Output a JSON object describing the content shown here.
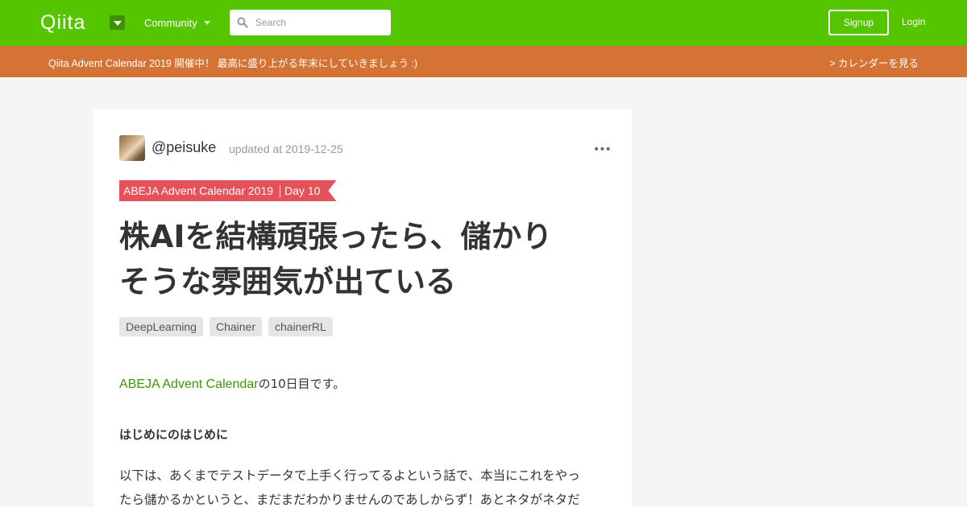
{
  "header": {
    "logo": "Qiita",
    "community_label": "Community",
    "search_placeholder": "Search",
    "signup_label": "Signup",
    "login_label": "Login"
  },
  "announcement": {
    "message": "Qiita Advent Calendar 2019 開催中！ 最高に盛り上がる年末にしていきましょう :)",
    "link": "> カレンダーを見る"
  },
  "article": {
    "author": "@peisuke",
    "updated": "updated at 2019-12-25",
    "more_icon": "•••",
    "calendar": {
      "name": "ABEJA Advent Calendar 2019",
      "day": "Day 10"
    },
    "title_line1": "株AIを結構頑張ったら、儲かり",
    "title_line2": "そうな雰囲気が出ている",
    "tags": [
      "DeepLearning",
      "Chainer",
      "chainerRL"
    ],
    "intro_link": "ABEJA Advent Calendar",
    "intro_text": "の10日目です。",
    "heading": "はじめにのはじめに",
    "body_line1": "以下は、あくまでテストデータで上手く行ってるよという話で、本当にこれをやっ",
    "body_line2": "たら儲かるかというと、まだまだわかりませんのであしからず！あとネタがネタだ"
  },
  "colors": {
    "header": "#55c500",
    "announce": "#d57334",
    "ribbon": "#e45159",
    "link": "#3f9500"
  }
}
